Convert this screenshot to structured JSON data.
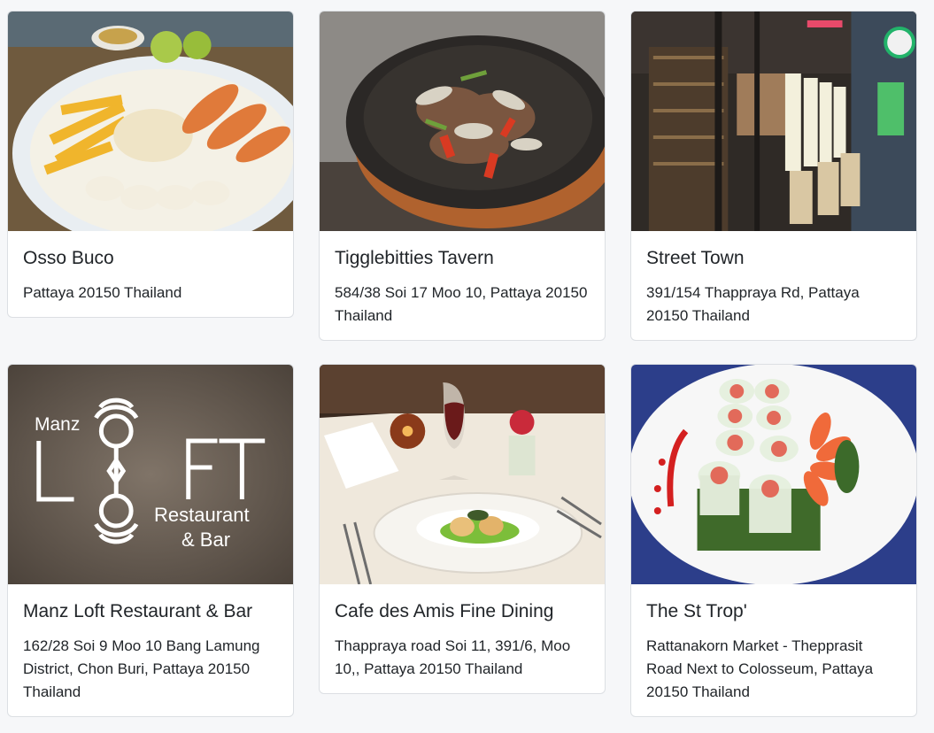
{
  "restaurants": [
    {
      "name": "Osso Buco",
      "address": "Pattaya 20150 Thailand",
      "image": "seafood-platter-photo"
    },
    {
      "name": "Tigglebitties Tavern",
      "address": "584/38 Soi 17 Moo 10, Pattaya 20150 Thailand",
      "image": "sizzling-beef-plate-photo"
    },
    {
      "name": "Street Town",
      "address": "391/154 Thappraya Rd, Pattaya 20150 Thailand",
      "image": "street-market-night-photo"
    },
    {
      "name": "Manz Loft Restaurant & Bar",
      "address": "162/28 Soi 9 Moo 10 Bang Lamung District, Chon Buri, Pattaya 20150 Thailand",
      "image": "manz-loft-logo",
      "logo": {
        "line1": "Manz",
        "line2a": "L",
        "line2b": "FT",
        "line3": "Restaurant",
        "line4": "& Bar"
      }
    },
    {
      "name": "Cafe des Amis Fine Dining",
      "address": "Thappraya road Soi 11, 391/6, Moo 10,, Pattaya 20150 Thailand",
      "image": "fine-dining-table-photo"
    },
    {
      "name": "The St Trop'",
      "address": "Rattanakorn Market - Thepprasit Road Next to Colosseum, Pattaya 20150 Thailand",
      "image": "spring-rolls-plate-photo"
    }
  ]
}
